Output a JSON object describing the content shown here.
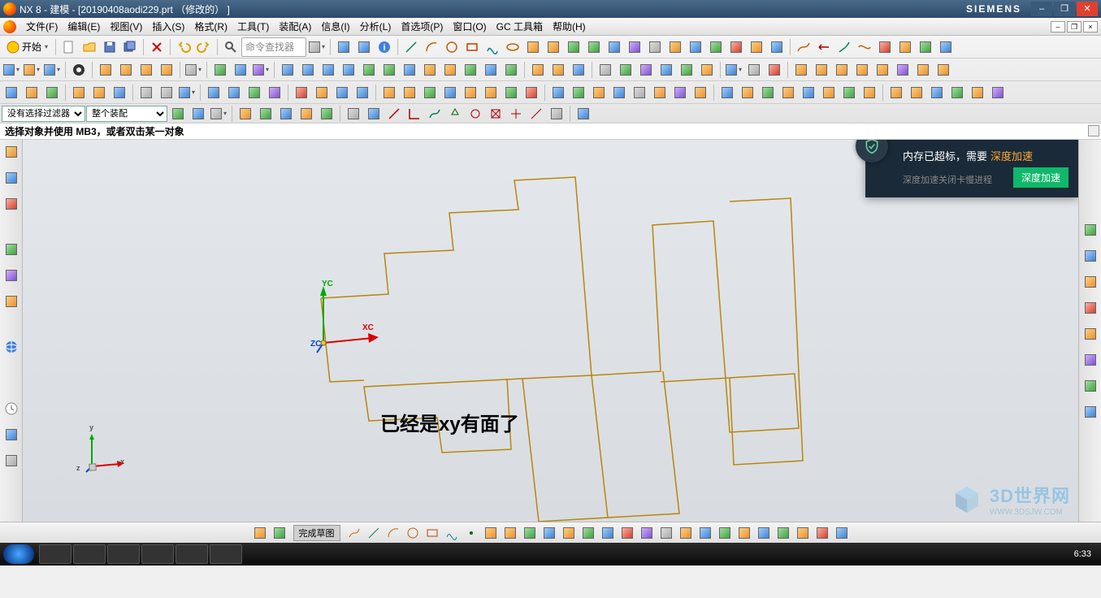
{
  "title": "NX 8 - 建模 - [20190408aodi229.prt （修改的） ]",
  "brand": "SIEMENS",
  "menu": {
    "file": "文件(F)",
    "edit": "编辑(E)",
    "view": "视图(V)",
    "insert": "插入(S)",
    "format": "格式(R)",
    "tools": "工具(T)",
    "assemblies": "装配(A)",
    "information": "信息(I)",
    "analysis": "分析(L)",
    "preferences": "首选项(P)",
    "window": "窗口(O)",
    "gctoolkit": "GC 工具箱",
    "help": "帮助(H)"
  },
  "toolbar": {
    "start": "开始",
    "cmdfinder": "命令查找器"
  },
  "filter": {
    "no_filter": "没有选择过滤器",
    "whole_assy": "整个装配"
  },
  "prompt": "选择对象并使用 MB3，或者双击某一对象",
  "csys": {
    "x": "XC",
    "y": "YC",
    "z": "ZC"
  },
  "mini_csys": {
    "x": "x",
    "y": "y",
    "z": "z"
  },
  "overlay": "已经是xy有面了",
  "sketch": {
    "finish": "完成草图"
  },
  "notify": {
    "line1a": "内存已超标，需要",
    "line1b": "深度加速",
    "line2": "深度加速关闭卡慢进程",
    "button": "深度加速"
  },
  "watermark": {
    "text": "3D世界网",
    "sub": "WWW.3DSJW.COM"
  },
  "clock": "6:33"
}
